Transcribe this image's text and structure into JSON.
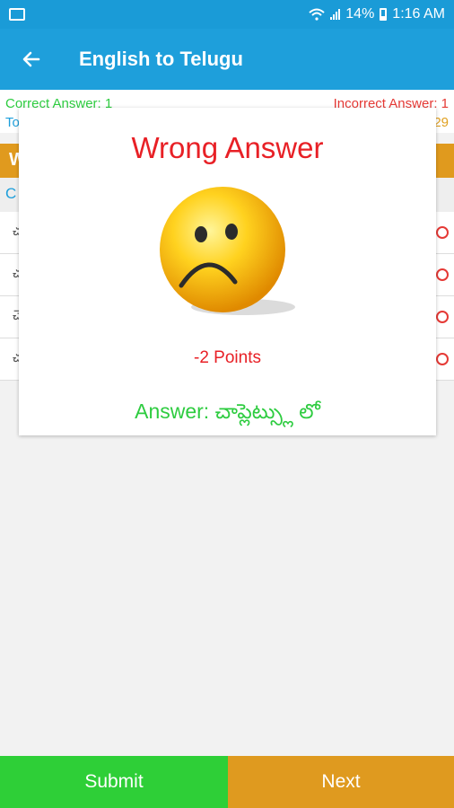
{
  "status_bar": {
    "battery": "14%",
    "time": "1:16 AM"
  },
  "app_bar": {
    "title": "English to Telugu"
  },
  "stats": {
    "correct": "Correct Answer: 1",
    "incorrect": "Incorrect Answer: 1",
    "total": "To",
    "score": "29"
  },
  "quiz": {
    "word_label": "W",
    "choose_label": "C",
    "options": [
      "చ",
      "చ",
      "చె",
      "చ"
    ]
  },
  "dialog": {
    "title": "Wrong Answer",
    "points": "-2 Points",
    "answer": "Answer: చాప్లెట్స్లు లో"
  },
  "bottom": {
    "submit_label": "Submit",
    "next_label": "Next"
  },
  "colors": {
    "primary": "#1e9fdb",
    "wrong": "#e82026",
    "correct": "#2ecc40",
    "accent": "#df9a1f"
  }
}
